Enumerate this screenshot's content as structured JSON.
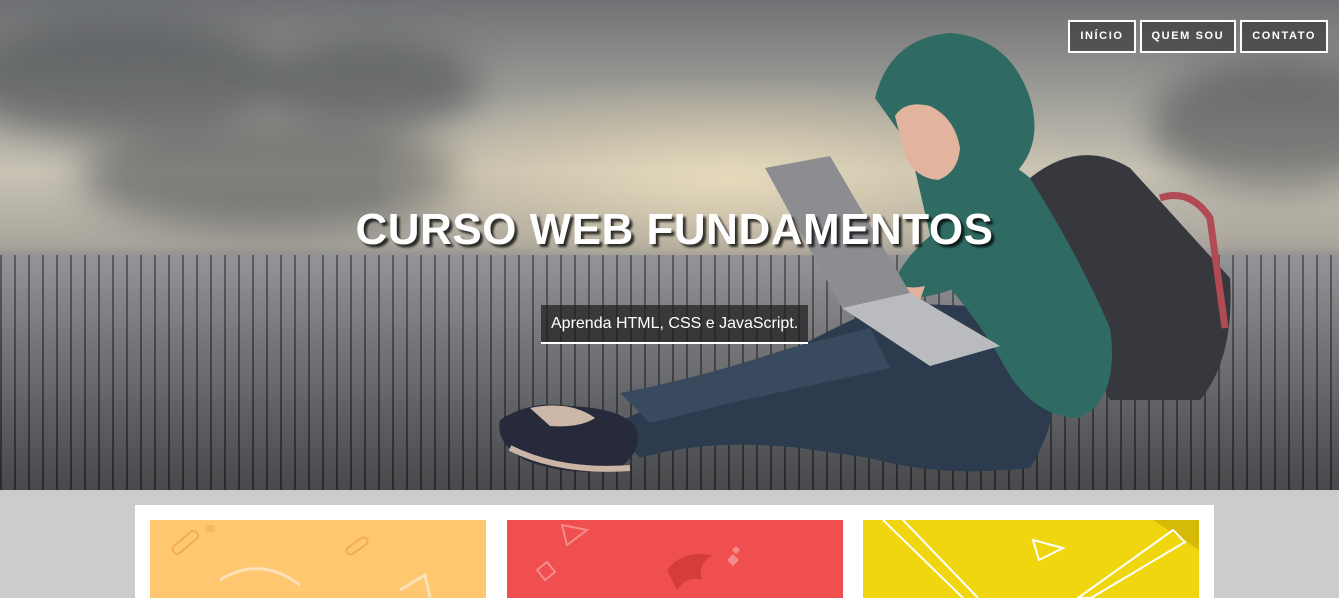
{
  "nav": {
    "items": [
      {
        "label": "INÍCIO"
      },
      {
        "label": "QUEM SOU"
      },
      {
        "label": "CONTATO"
      }
    ]
  },
  "hero": {
    "title": "CURSO WEB FUNDAMENTOS",
    "subtitle": "Aprenda HTML, CSS e JavaScript."
  },
  "cards": [
    {
      "name": "html-card",
      "color": "#ffc870"
    },
    {
      "name": "css-card",
      "color": "#ef4f4f"
    },
    {
      "name": "javascript-card",
      "color": "#f0d60e"
    }
  ],
  "colors": {
    "page_background": "#cccccc",
    "nav_border": "#ffffff",
    "content_background": "#ffffff"
  }
}
